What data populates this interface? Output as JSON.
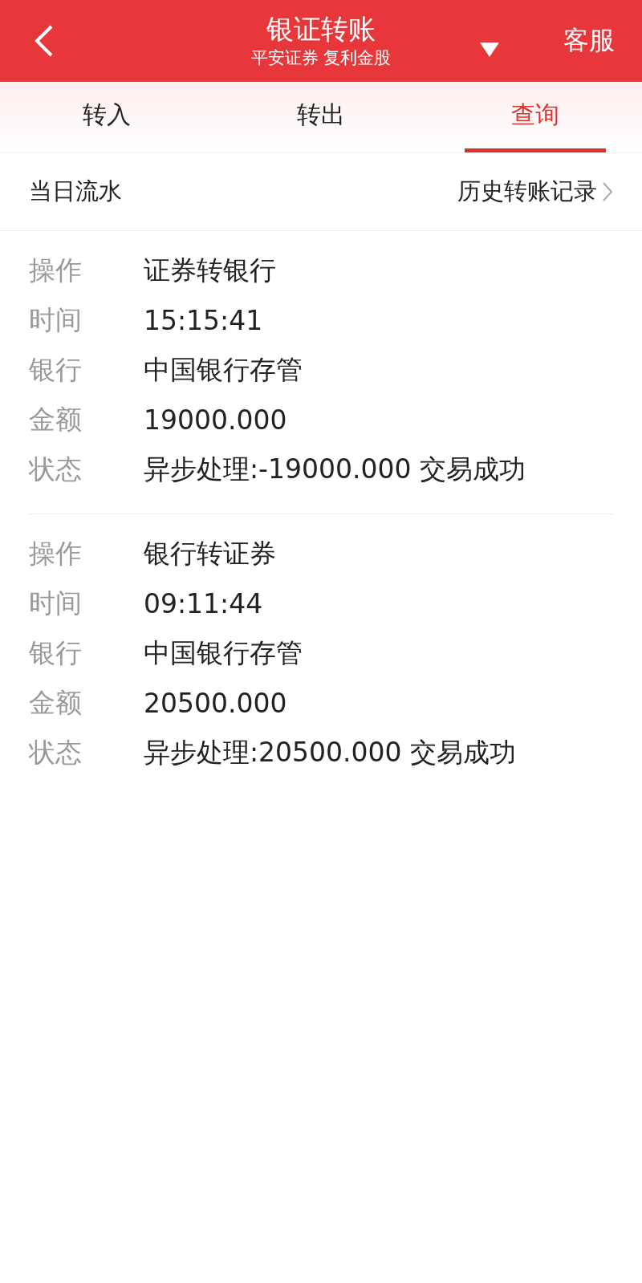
{
  "header": {
    "title": "银证转账",
    "subtitle": "平安证券 复利金股",
    "service": "客服"
  },
  "tabs": [
    {
      "label": "转入",
      "selected": false
    },
    {
      "label": "转出",
      "selected": false
    },
    {
      "label": "查询",
      "selected": true
    }
  ],
  "section": {
    "title": "当日流水",
    "history_link": "历史转账记录"
  },
  "records": [
    {
      "fields": [
        {
          "label": "操作",
          "value": "证券转银行"
        },
        {
          "label": "时间",
          "value": "15:15:41"
        },
        {
          "label": "银行",
          "value": "中国银行存管"
        },
        {
          "label": "金额",
          "value": "19000.000"
        },
        {
          "label": "状态",
          "value": "异步处理:-19000.000 交易成功"
        }
      ]
    },
    {
      "fields": [
        {
          "label": "操作",
          "value": "银行转证券"
        },
        {
          "label": "时间",
          "value": "09:11:44"
        },
        {
          "label": "银行",
          "value": "中国银行存管"
        },
        {
          "label": "金额",
          "value": "20500.000"
        },
        {
          "label": "状态",
          "value": "异步处理:20500.000 交易成功"
        }
      ]
    }
  ]
}
